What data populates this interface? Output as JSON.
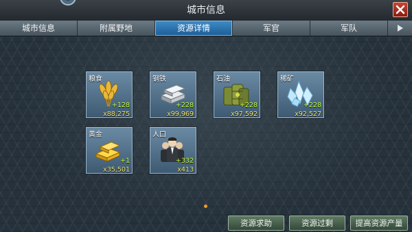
{
  "window": {
    "title": "城市信息"
  },
  "tabs": [
    {
      "label": "城市信息"
    },
    {
      "label": "附属野地"
    },
    {
      "label": "资源详情"
    },
    {
      "label": "军官"
    },
    {
      "label": "军队"
    }
  ],
  "active_tab": "资源详情",
  "resources": [
    {
      "name": "粮食",
      "rate": "+128",
      "total": "x88,275",
      "icon": "wheat-icon"
    },
    {
      "name": "钢铁",
      "rate": "+228",
      "total": "x99,969",
      "icon": "steel-ingot-icon"
    },
    {
      "name": "石油",
      "rate": "+228",
      "total": "x97,592",
      "icon": "oil-barrels-icon"
    },
    {
      "name": "稀矿",
      "rate": "+228",
      "total": "x92,527",
      "icon": "crystal-icon"
    },
    {
      "name": "黄金",
      "rate": "+1",
      "total": "x35,501",
      "icon": "gold-bars-icon"
    },
    {
      "name": "人口",
      "rate": "+332",
      "total": "x413",
      "icon": "population-icon"
    }
  ],
  "buttons": {
    "request": "资源求助",
    "overflow": "资源过剩",
    "boost": "提高资源产量"
  },
  "colors": {
    "rate": "#c8ff3c",
    "total": "#f4e36a",
    "active_tab": "#2f78b5",
    "close": "#b0321f"
  }
}
